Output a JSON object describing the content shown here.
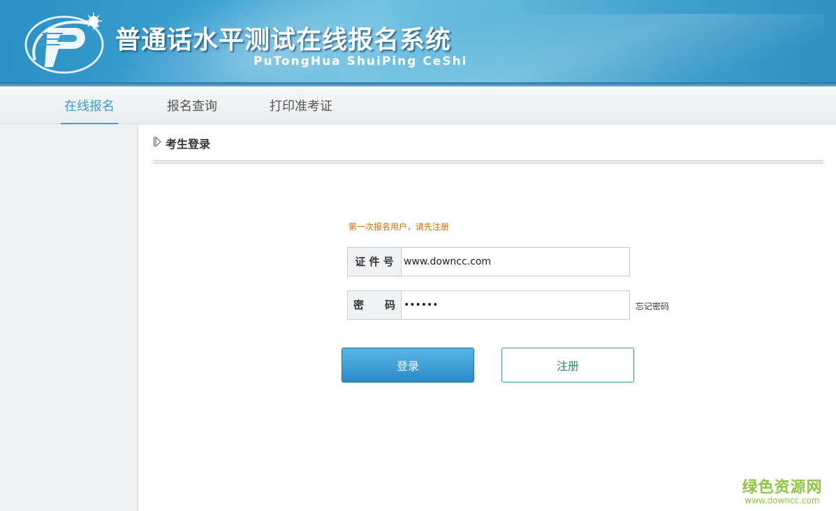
{
  "header": {
    "title": "普通话水平测试在线报名系统",
    "subtitle": "PuTongHua ShuiPing CeShi",
    "logo_icon": "putonghua-p-logo-icon",
    "colors": {
      "banner": "#3aa0d0",
      "accent": "#3a9bd5"
    }
  },
  "nav": {
    "items": [
      {
        "label": "在线报名",
        "active": true
      },
      {
        "label": "报名查询",
        "active": false
      },
      {
        "label": "打印准考证",
        "active": false
      }
    ]
  },
  "panel": {
    "title": "考生登录",
    "title_icon": "triangle-arrow-right-icon"
  },
  "login": {
    "notice": "第一次报名用户，请先注册",
    "id_label": "证 件 号",
    "id_value": "www.downcc.com",
    "password_label": "密　　码",
    "password_value": "••••••",
    "forgot_label": "忘记密码",
    "login_button": "登录",
    "register_button": "注册",
    "colors": {
      "notice": "#d46d05",
      "login_button": "#2a8bc8",
      "register_border": "#3a9d7a"
    }
  },
  "watermark": {
    "text": "绿色资源网",
    "url": "www.downcc.com",
    "color": "#8cc63f"
  }
}
